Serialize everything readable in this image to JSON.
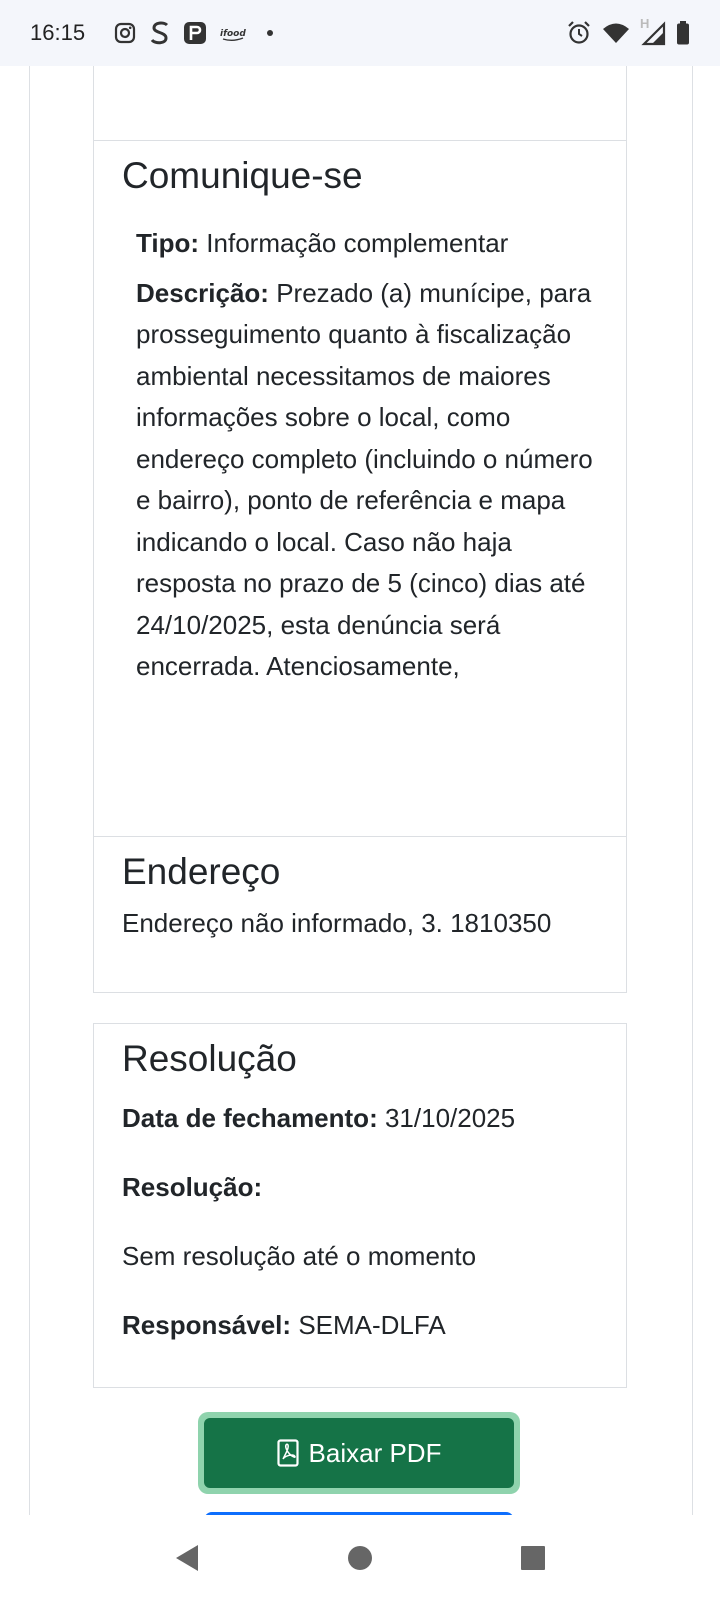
{
  "status_bar": {
    "time": "16:15",
    "left_icons": [
      "instagram-icon",
      "s-app-icon",
      "p-app-icon",
      "ifood-icon",
      "dot-icon"
    ],
    "ifood_label": "ifood",
    "right_icons": [
      "alarm-icon",
      "wifi-icon",
      "h-network-icon",
      "signal-icon",
      "battery-icon"
    ],
    "network_letter": "H"
  },
  "comunique": {
    "title": "Comunique-se",
    "tipo_label": "Tipo:",
    "tipo_value": "Informação complementar",
    "descricao_label": "Descrição:",
    "descricao_value": "Prezado (a) munícipe, para prosseguimento quanto à fiscalização ambiental necessitamos de maiores informações sobre o local, como endereço completo (incluindo o número e bairro), ponto de referência e mapa indicando o local. Caso não haja resposta no prazo de 5 (cinco) dias até 24/10/2025, esta denúncia será encerrada. Atenciosamente,"
  },
  "endereco": {
    "title": "Endereço",
    "value": "Endereço não informado, 3. 1810350"
  },
  "resolucao": {
    "title": "Resolução",
    "data_label": "Data de fechamento:",
    "data_value": "31/10/2025",
    "resolucao_label": "Resolução:",
    "resolucao_value": "Sem resolução até o momento",
    "responsavel_label": "Responsável:",
    "responsavel_value": "SEMA-DLFA"
  },
  "actions": {
    "pdf_label": "Baixar PDF",
    "pdf_icon": "file-pdf-icon"
  },
  "colors": {
    "pdf_button": "#157347",
    "pdf_focus_ring": "#8fd3ad",
    "next_button": "#0d6efd",
    "status_bar_bg": "#f4f6fb"
  },
  "nav": {
    "buttons": [
      "back-icon",
      "home-icon",
      "recents-icon"
    ]
  }
}
